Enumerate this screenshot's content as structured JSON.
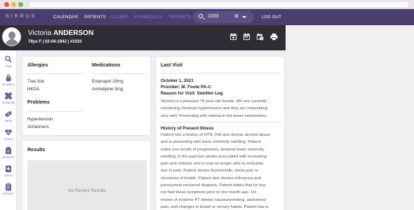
{
  "app": {
    "logo": "SIRRUS"
  },
  "nav": {
    "items": [
      {
        "label": "CALENDAR",
        "state": "active"
      },
      {
        "label": "PATIENTS",
        "state": "active"
      },
      {
        "label": "CLAIMS",
        "state": "dim"
      },
      {
        "label": "FINANCIALS",
        "state": "dim"
      },
      {
        "label": "REPORTS",
        "state": "dim"
      }
    ],
    "search_value": "1033",
    "logout": "LOG OUT"
  },
  "patient": {
    "first_name": "Victoria",
    "last_name": "ANDERSON",
    "info": "79yo F | 02-04-1943 | #1033"
  },
  "header_icons": [
    "calendar-add-icon",
    "calendar-icon",
    "calendar-clock-icon",
    "printer-icon"
  ],
  "sidebar": {
    "items": [
      {
        "label": "FIND",
        "icon": "search-icon"
      },
      {
        "label": "ALLERGY",
        "icon": "hand-icon"
      },
      {
        "label": "PROBLEM",
        "icon": "bandage-icon"
      },
      {
        "label": "MEDS",
        "icon": "pill-icon"
      },
      {
        "label": "VITALS",
        "icon": "heart-icon"
      },
      {
        "label": "RESULTS",
        "icon": "flask-icon"
      },
      {
        "label": "VISITS",
        "icon": "stethoscope-icon"
      },
      {
        "label": "HISTORY",
        "icon": "clipboard-icon"
      }
    ]
  },
  "summary": {
    "allergies_title": "Allergies",
    "allergies": [
      "Tree Nut",
      "NKDA"
    ],
    "medications_title": "Medications",
    "medications": [
      "Enlanapril 20mg",
      "Amlodipine 5mg"
    ],
    "problems_title": "Problems",
    "problems": [
      "Hypertension",
      "Alzheimers"
    ]
  },
  "results": {
    "title": "Results",
    "empty": "No Recent Results"
  },
  "last_visit": {
    "title": "Last Visit",
    "date": "October 1, 2021",
    "provider": "Provider: M. Foote PA-C",
    "reason": "Reason for Visit: Swollen Leg",
    "summary_lines": [
      "Victoria is a pleasant 79 year-old female. We are currently",
      "monitoring Victorias hypertension and they are responding",
      "very well. Presenting with edema in the lower extremeties."
    ],
    "hpi_title": "History of Present Illness",
    "hpi_lines": [
      "Patient has a history of HTN, DM and chronic alcohol abuse",
      "and is presenting with lower extremity swelling. Patient",
      "notes one month of progressive, bilateral lower extremity",
      "swelling, in the past two weeks associated with increasing",
      "pain and redness and is now no longer able to ambulate",
      "due to pain. Patient denies fevers/chills, chest pain or",
      "shortness of breath. Patient also denies orthopnea and",
      "paroxysmal nocturnal dyspnea. Patient states that he has",
      "not had these symptoms prior to one month ago. On",
      "review of systems PT denies nausea/vomiting, abdominal",
      "pain, and changes in bowel or urinary habits. Patient has a"
    ]
  },
  "colors": {
    "nav_bg": "#4a3e6e",
    "patient_header_bg": "#2f2c35",
    "accent": "#6b5f8f",
    "page_bg": "#f0eff2"
  }
}
